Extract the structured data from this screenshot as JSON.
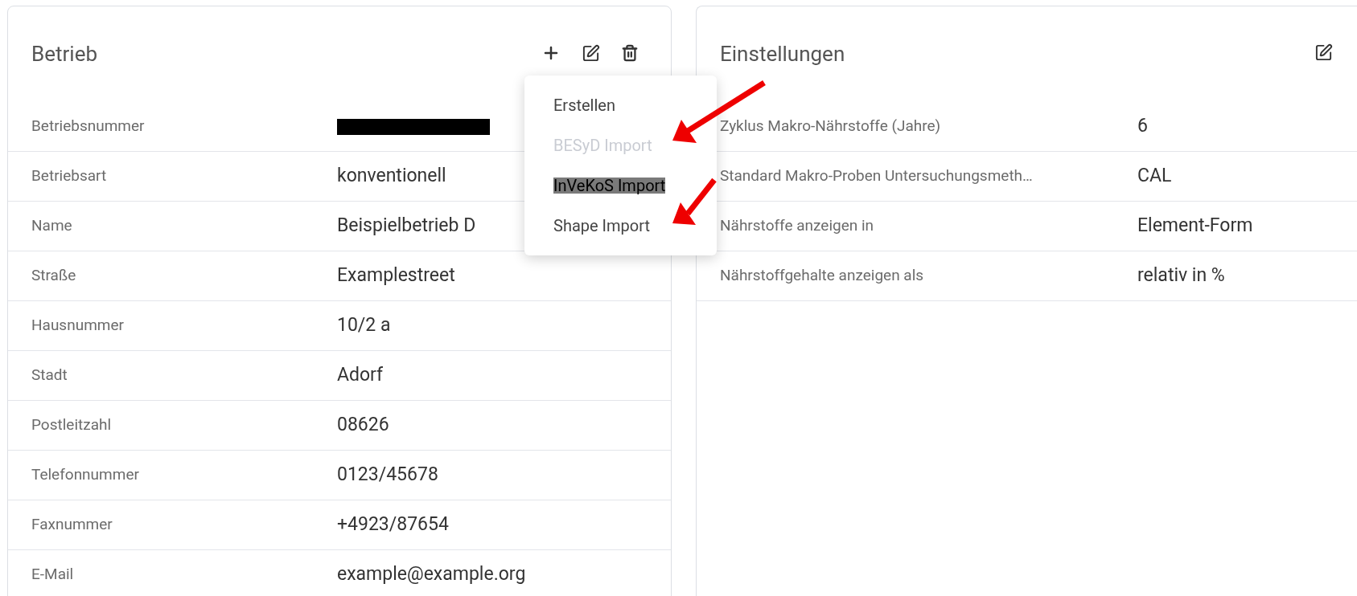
{
  "betrieb": {
    "title": "Betrieb",
    "rows": [
      {
        "label": "Betriebsnummer",
        "kind": "redacted"
      },
      {
        "label": "Betriebsart",
        "kind": "text",
        "value": "konventionell"
      },
      {
        "label": "Name",
        "kind": "text",
        "value": "Beispielbetrieb D"
      },
      {
        "label": "Straße",
        "kind": "text",
        "value": "Examplestreet"
      },
      {
        "label": "Hausnummer",
        "kind": "text",
        "value": "10/2 a"
      },
      {
        "label": "Stadt",
        "kind": "text",
        "value": "Adorf"
      },
      {
        "label": "Postleitzahl",
        "kind": "text",
        "value": "08626"
      },
      {
        "label": "Telefonnummer",
        "kind": "text",
        "value": "0123/45678"
      },
      {
        "label": "Faxnummer",
        "kind": "text",
        "value": "+4923/87654"
      },
      {
        "label": "E-Mail",
        "kind": "text",
        "value": "example@example.org"
      }
    ],
    "menu": [
      {
        "label": "Erstellen",
        "disabled": false,
        "highlighted": false
      },
      {
        "label": "BESyD Import",
        "disabled": true,
        "highlighted": false
      },
      {
        "label": "InVeKoS Import",
        "disabled": false,
        "highlighted": true
      },
      {
        "label": "Shape Import",
        "disabled": false,
        "highlighted": false
      }
    ]
  },
  "einstellungen": {
    "title": "Einstellungen",
    "rows": [
      {
        "label": "Zyklus Makro-Nährstoffe (Jahre)",
        "value": "6"
      },
      {
        "label": "Standard Makro-Proben Untersuchungsmeth…",
        "value": "CAL"
      },
      {
        "label": "Nährstoffe anzeigen in",
        "value": "Element-Form"
      },
      {
        "label": "Nährstoffgehalte anzeigen als",
        "value": "relativ in %"
      }
    ]
  }
}
